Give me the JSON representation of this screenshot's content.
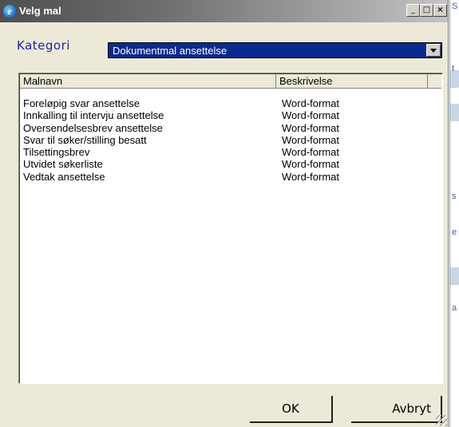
{
  "window": {
    "title": "Velg mal",
    "icon": "ie-icon",
    "controls": {
      "minimize": "_",
      "maximize": "□",
      "close": "×"
    }
  },
  "kategori": {
    "label": "Kategori",
    "selected": "Dokumentmal ansettelse"
  },
  "list": {
    "columns": [
      "Malnavn",
      "Beskrivelse"
    ],
    "rows": [
      {
        "name": "Foreløpig svar ansettelse",
        "desc": "Word-format"
      },
      {
        "name": "Innkalling til intervju ansettelse",
        "desc": "Word-format"
      },
      {
        "name": "Oversendelsesbrev ansettelse",
        "desc": "Word-format"
      },
      {
        "name": "Svar til søker/stilling besatt",
        "desc": "Word-format"
      },
      {
        "name": "Tilsettingsbrev",
        "desc": "Word-format"
      },
      {
        "name": "Utvidet søkerliste",
        "desc": "Word-format"
      },
      {
        "name": "Vedtak ansettelse",
        "desc": "Word-format"
      }
    ]
  },
  "buttons": {
    "ok": "OK",
    "cancel": "Avbryt"
  },
  "background_window": {
    "chars": [
      "S",
      "t",
      "s",
      "e",
      "a"
    ]
  }
}
